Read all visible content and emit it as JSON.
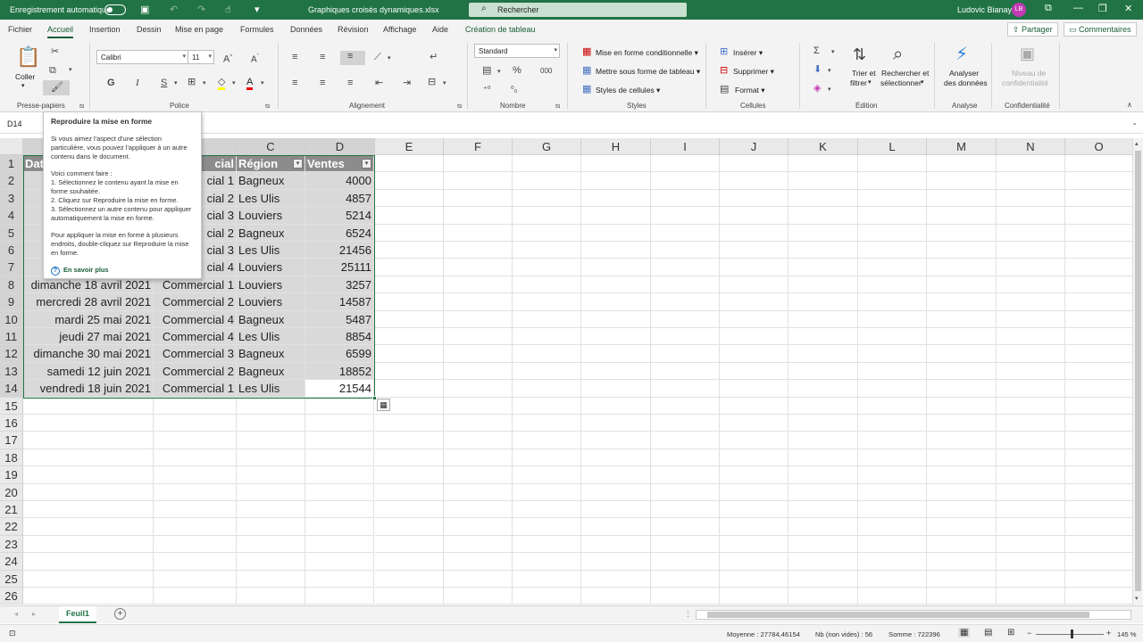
{
  "titlebar": {
    "autosave": "Enregistrement automatique",
    "filename": "Graphiques croisés dynamiques.xlsx",
    "search": "Rechercher",
    "user": "Ludovic Bianay",
    "initials": "LB"
  },
  "tabs": [
    "Fichier",
    "Accueil",
    "Insertion",
    "Dessin",
    "Mise en page",
    "Formules",
    "Données",
    "Révision",
    "Affichage",
    "Aide",
    "Création de tableau"
  ],
  "share": "Partager",
  "comments": "Commentaires",
  "ribbon": {
    "coller": "Coller",
    "font": "Calibri",
    "size": "11",
    "bold": "G",
    "italic": "I",
    "underline": "S",
    "format": "Standard",
    "cond": "Mise en forme conditionnelle",
    "tableformat": "Mettre sous forme de tableau",
    "cellstyles": "Styles de cellules",
    "insert": "Insérer",
    "delete": "Supprimer",
    "formatcell": "Format",
    "sort1": "Trier et",
    "sort2": "filtrer",
    "find1": "Rechercher et",
    "find2": "sélectionner",
    "analyse1": "Analyser",
    "analyse2": "des données",
    "conf1": "Niveau de",
    "conf2": "confidentialité",
    "groups": [
      "Presse-papiers",
      "Police",
      "Alignement",
      "Nombre",
      "Styles",
      "Cellules",
      "Édition",
      "Analyse",
      "Confidentialité"
    ]
  },
  "namebox": "D14",
  "columns": [
    "C",
    "D",
    "E",
    "F",
    "G",
    "H",
    "I",
    "J",
    "K",
    "L",
    "M",
    "N",
    "O"
  ],
  "rows": [
    "1",
    "2",
    "3",
    "4",
    "5",
    "6",
    "7",
    "8",
    "9",
    "10",
    "11",
    "12",
    "13",
    "14",
    "15",
    "16",
    "17",
    "18",
    "19",
    "20",
    "21",
    "22",
    "23",
    "24",
    "25",
    "26"
  ],
  "table": {
    "headers": [
      "Dat",
      "cial",
      "Région",
      "Ventes"
    ],
    "data": [
      [
        "",
        "cial 1",
        "Bagneux",
        "4000"
      ],
      [
        "",
        "cial 2",
        "Les Ulis",
        "4857"
      ],
      [
        "m",
        "cial 3",
        "Louviers",
        "5214"
      ],
      [
        "",
        "cial 2",
        "Bagneux",
        "6524"
      ],
      [
        "",
        "cial 3",
        "Les Ulis",
        "21456"
      ],
      [
        "",
        "cial 4",
        "Louviers",
        "25111"
      ],
      [
        "dimanche 18 avril 2021",
        "Commercial 1",
        "Louviers",
        "3257"
      ],
      [
        "mercredi 28 avril 2021",
        "Commercial 2",
        "Louviers",
        "14587"
      ],
      [
        "mardi 25 mai 2021",
        "Commercial 4",
        "Bagneux",
        "5487"
      ],
      [
        "jeudi 27 mai 2021",
        "Commercial 4",
        "Les Ulis",
        "8854"
      ],
      [
        "dimanche 30 mai 2021",
        "Commercial 3",
        "Bagneux",
        "6599"
      ],
      [
        "samedi 12 juin 2021",
        "Commercial 2",
        "Bagneux",
        "18852"
      ],
      [
        "vendredi 18 juin 2021",
        "Commercial 1",
        "Les Ulis",
        "21544"
      ]
    ]
  },
  "tooltip": {
    "title": "Reproduire la mise en forme",
    "p1": "Si vous aimez l'aspect d'une sélection particulière, vous pouvez l'appliquer à un autre contenu dans le document.",
    "p2": "Voici comment faire :",
    "s1": "1. Sélectionnez le contenu ayant la mise en forme souhaitée.",
    "s2": "2. Cliquez sur Reproduire la mise en forme.",
    "s3": "3. Sélectionnez un autre contenu pour appliquer automatiquement la mise en forme.",
    "p3": "Pour appliquer la mise en forme à plusieurs endroits, double-cliquez sur Reproduire la mise en forme.",
    "more": "En savoir plus"
  },
  "sheet": "Feuil1",
  "status": {
    "avg": "Moyenne : 27784,46154",
    "count": "Nb (non vides) : 56",
    "sum": "Somme : 722396",
    "zoom": "145 %"
  }
}
